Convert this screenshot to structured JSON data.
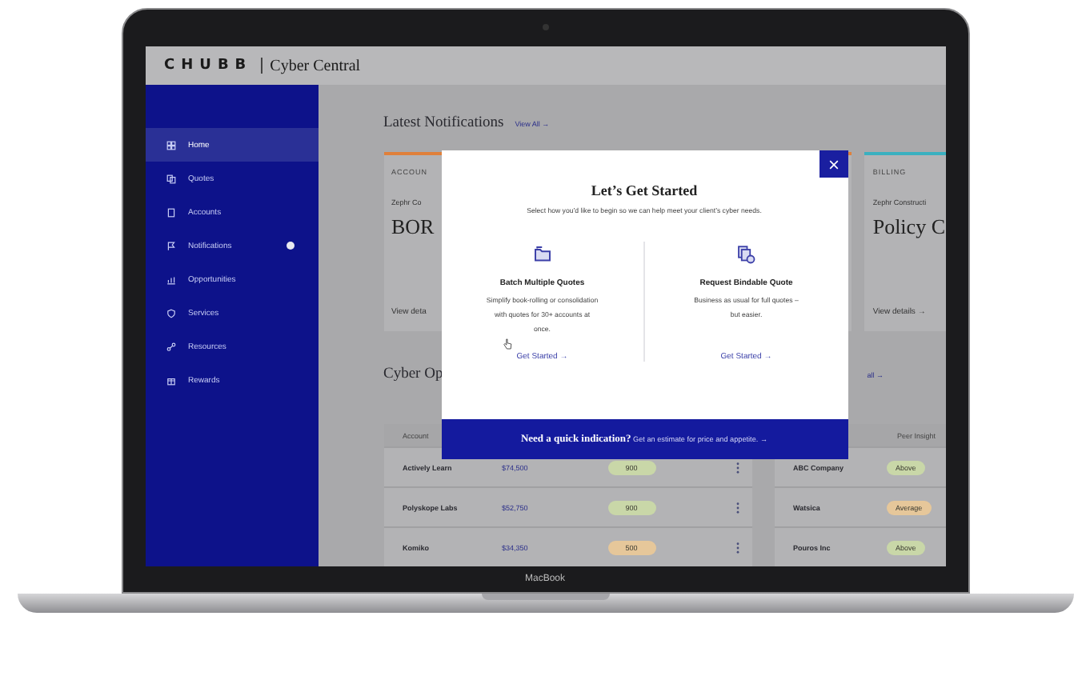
{
  "laptop": {
    "label": "MacBook"
  },
  "header": {
    "brand": "CHUBB",
    "product": "Cyber Central"
  },
  "sidebar": {
    "items": [
      {
        "label": "Home",
        "selected": true,
        "badge": false
      },
      {
        "label": "Quotes",
        "selected": false,
        "badge": false
      },
      {
        "label": "Accounts",
        "selected": false,
        "badge": false
      },
      {
        "label": "Notifications",
        "selected": false,
        "badge": true
      },
      {
        "label": "Opportunities",
        "selected": false,
        "badge": false
      },
      {
        "label": "Services",
        "selected": false,
        "badge": false
      },
      {
        "label": "Resources",
        "selected": false,
        "badge": false
      },
      {
        "label": "Rewards",
        "selected": false,
        "badge": false
      }
    ]
  },
  "notifications": {
    "title": "Latest Notifications",
    "link": "View All →",
    "cards": [
      {
        "category": "ACCOUN",
        "company": "Zephr Co",
        "headline": "BOR",
        "link": "View deta",
        "color": "#e0803a"
      },
      {
        "category": "BILLING",
        "company": "Zephr Constructi",
        "headline": "Policy C",
        "link": "View details →",
        "color": "#3ab0c0"
      }
    ]
  },
  "opportunities": {
    "title": "Cyber Op",
    "link": "all →",
    "left_table": {
      "header": "Account",
      "rows": [
        {
          "account": "Actively Learn",
          "premium": "$74,500",
          "score": "900",
          "color": "#c9d7a8"
        },
        {
          "account": "Polyskope Labs",
          "premium": "$52,750",
          "score": "900",
          "color": "#c9d7a8"
        },
        {
          "account": "Komiko",
          "premium": "$34,350",
          "score": "500",
          "color": "#e6c79a"
        }
      ]
    },
    "right_table": {
      "header": "Peer Insight",
      "rows": [
        {
          "account": "ABC Company",
          "insight": "Above",
          "color": "#c9d7a8"
        },
        {
          "account": "Watsica",
          "insight": "Average",
          "color": "#e6c79a"
        },
        {
          "account": "Pouros Inc",
          "insight": "Above",
          "color": "#c9d7a8"
        }
      ]
    }
  },
  "modal": {
    "title": "Let’s Get Started",
    "subtitle": "Select how you’d like to begin so we can help meet your client’s cyber needs.",
    "options": [
      {
        "title": "Batch Multiple Quotes",
        "text": "Simplify book-rolling or consolidation with quotes for 30+ accounts at once.",
        "link": "Get Started →"
      },
      {
        "title": "Request Bindable Quote",
        "text": "Business as usual for full quotes – but easier.",
        "link": "Get Started →"
      }
    ],
    "banner": "**Need a quick indication?** Get an estimate for price and appetite. →"
  }
}
